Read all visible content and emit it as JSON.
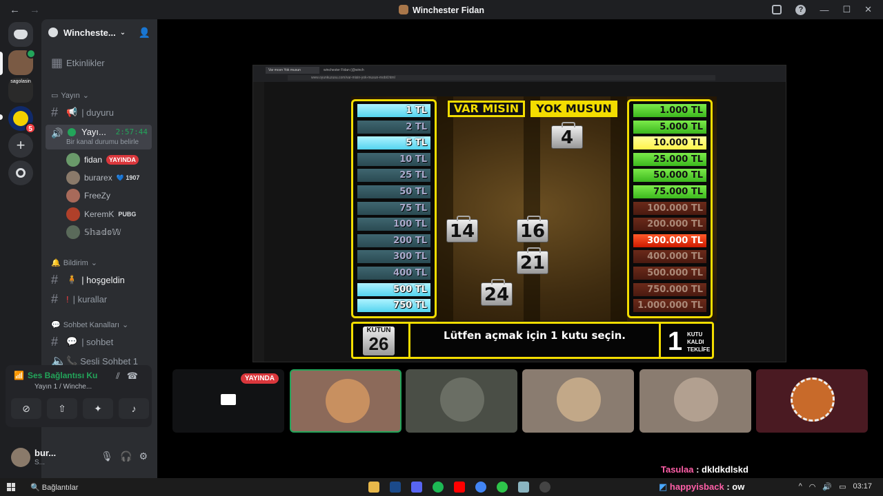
{
  "window": {
    "title": "Winchester Fidan",
    "back": "←",
    "forward": "→"
  },
  "server": {
    "name": "Wincheste...",
    "srv2_text": "sagolasin",
    "srv3_badge": "5"
  },
  "channels": {
    "events": "Etkinlikler",
    "cat_yayin": "Yayın",
    "duyuru": "| duyuru",
    "voice": {
      "name": "Yayı...",
      "time": "2:57:44",
      "sub": "Bir kanal durumu belirle"
    },
    "users": [
      {
        "name": "fidan",
        "tag": "YAYINDA"
      },
      {
        "name": "burarex",
        "tag": "💙 1907"
      },
      {
        "name": "FreeZy",
        "tag": ""
      },
      {
        "name": "KeremK",
        "tag": "PUBG"
      },
      {
        "name": "𝕊𝕙𝕒𝕕𝕠𝕎",
        "tag": ""
      }
    ],
    "cat_bildirim": "Bildirim",
    "hosgeldin": "| hoşgeldin",
    "kurallar": "| kurallar",
    "cat_sohbet": "Sohbet Kanalları",
    "sohbet": "| sohbet",
    "sesli": "Sesli Sohbet 1"
  },
  "panel": {
    "status": "Ses Bağlantısı Ku",
    "channel": "Yayın 1 / Winche..."
  },
  "me": {
    "name": "bur...",
    "status": "S..."
  },
  "game": {
    "title_left": "VAR MISIN",
    "title_right": "YOK MUSUN",
    "left_prizes": [
      "1 TL",
      "2 TL",
      "5 TL",
      "10 TL",
      "25 TL",
      "50 TL",
      "75 TL",
      "100 TL",
      "200 TL",
      "300 TL",
      "400 TL",
      "500 TL",
      "750 TL"
    ],
    "right_prizes": [
      "1.000 TL",
      "5.000 TL",
      "10.000 TL",
      "25.000 TL",
      "50.000 TL",
      "75.000 TL",
      "100.000 TL",
      "200.000 TL",
      "300.000 TL",
      "400.000 TL",
      "500.000 TL",
      "750.000 TL",
      "1.000.000 TL"
    ],
    "cases": [
      "4",
      "14",
      "16",
      "21",
      "24"
    ],
    "kutun_label": "KUTUN",
    "kutun_value": "26",
    "message": "Lütfen açmak için 1 kutu seçin.",
    "teklif_number": "1",
    "teklif_text_1": "KUTU",
    "teklif_text_2": "KALDI",
    "teklif_text_3": "TEKLİFE",
    "browser_tab": "Var mısın Yok musun",
    "browser_tab2": "winchester Fidan (@winch",
    "browser_url": "www.oyunkuzusu.com/var-misin-yok-musun-mobil.html"
  },
  "tiles": {
    "live_label": "YAYINDA"
  },
  "chat": [
    {
      "user": "Tasulaa",
      "text": ": dkldkdlskd",
      "color": "#ff5fa8"
    },
    {
      "user": "happyisback",
      "text": ": ow",
      "color": "#ff5fa8"
    }
  ],
  "taskbar": {
    "search": "Bağlantılar",
    "time": "03:17"
  }
}
